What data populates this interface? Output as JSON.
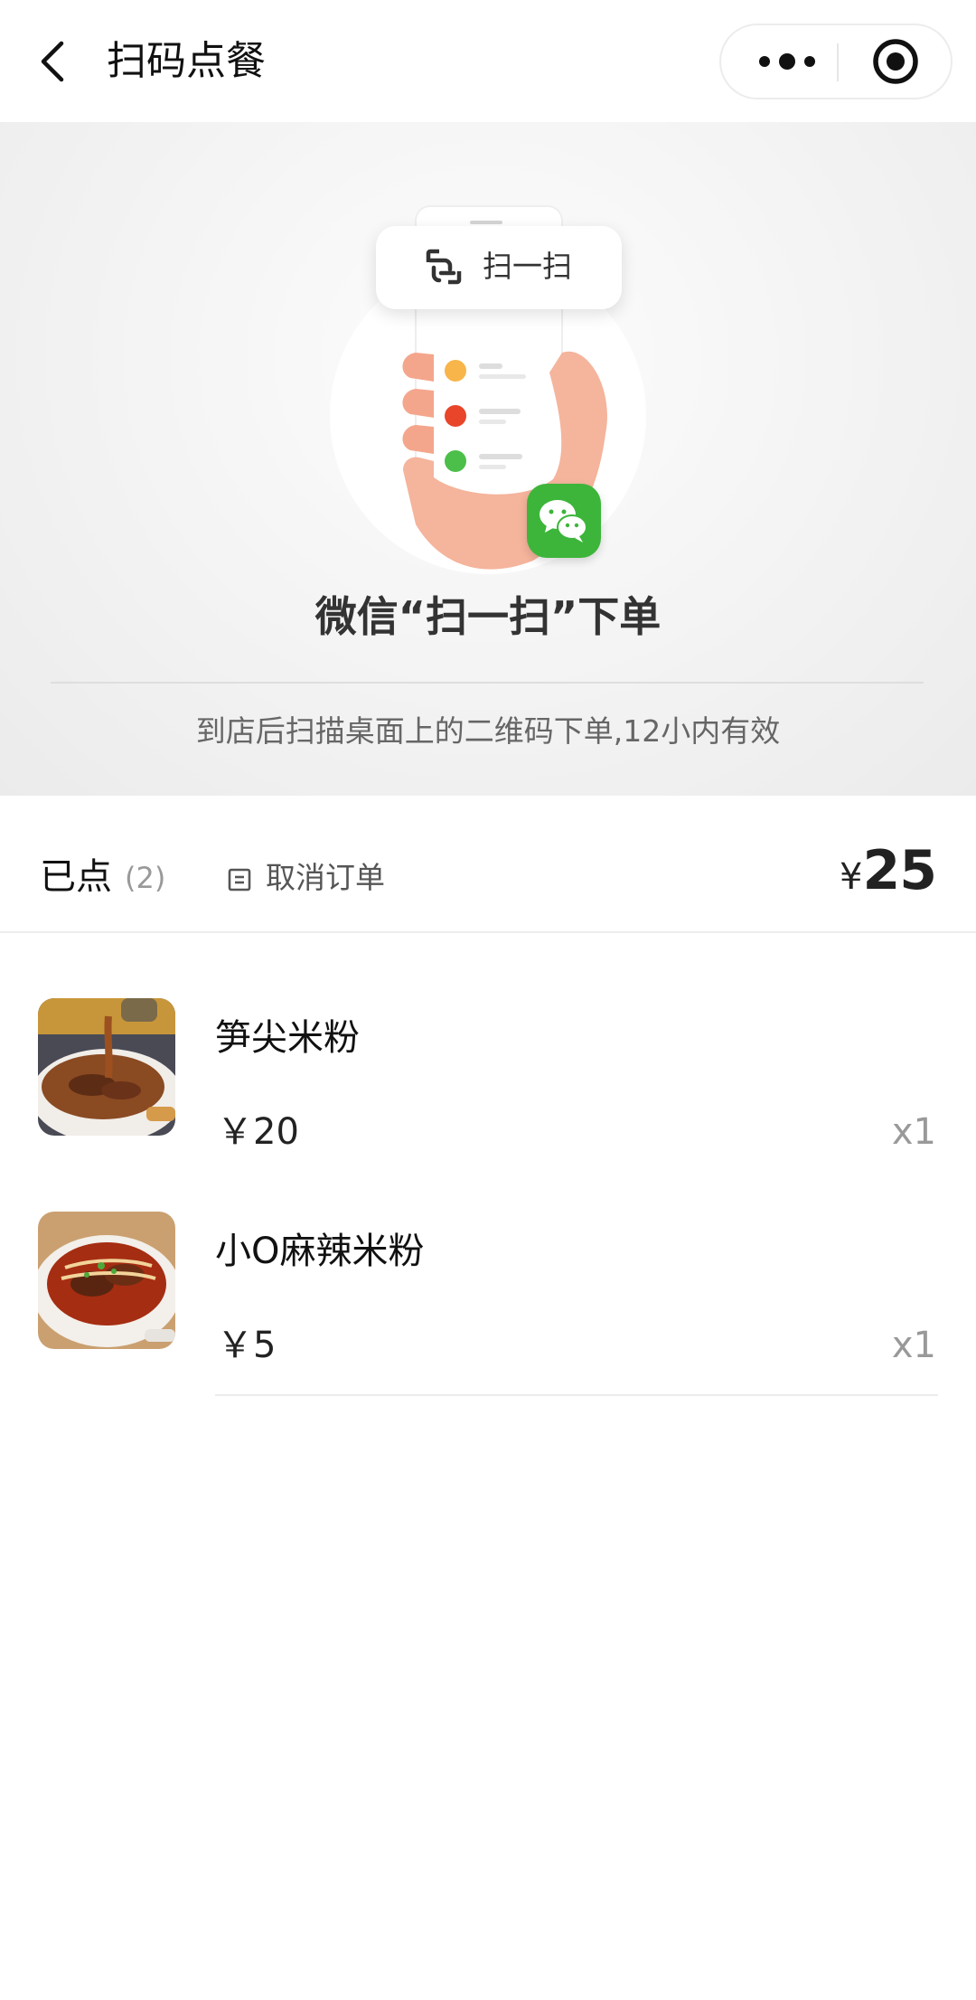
{
  "navbar": {
    "title": "扫码点餐"
  },
  "banner": {
    "popup_label": "扫一扫",
    "title": "微信“扫一扫”下单",
    "subtitle": "到店后扫描桌面上的二维码下单,12小内有效"
  },
  "summary": {
    "ordered_label": "已点",
    "ordered_count": "(2)",
    "cancel_label": "取消订单",
    "currency": "¥",
    "total": "25"
  },
  "items": [
    {
      "name": "笋尖米粉",
      "price": "￥20",
      "qty": "x1"
    },
    {
      "name": "小O麻辣米粉",
      "price": "￥5",
      "qty": "x1"
    }
  ],
  "colors": {
    "wechat_green": "#3db53a",
    "dot_orange": "#f7b54a",
    "dot_red": "#e8452a",
    "dot_green": "#4cbf4a"
  }
}
